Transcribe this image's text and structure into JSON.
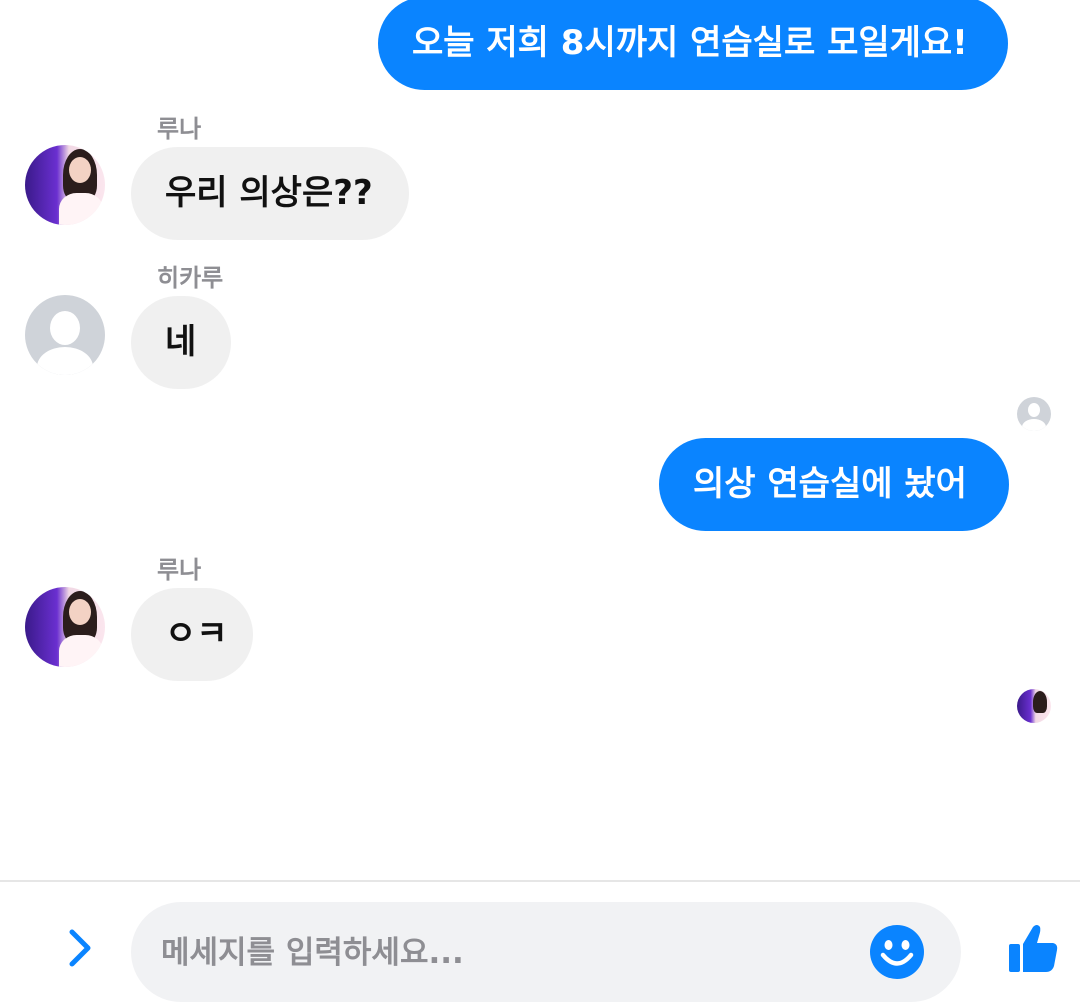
{
  "messages": [
    {
      "direction": "out",
      "text": "오늘 저희 8시까지 연습실로 모일게요!"
    },
    {
      "direction": "in",
      "sender": "루나",
      "text": "우리 의상은??"
    },
    {
      "direction": "in",
      "sender": "히카루",
      "text": "네"
    },
    {
      "direction": "out",
      "text": "의상 연습실에 놨어"
    },
    {
      "direction": "in",
      "sender": "루나",
      "text": "ㅇㅋ"
    }
  ],
  "composer": {
    "placeholder": "메세지를 입력하세요..."
  },
  "icons": {
    "expand": "chevron-right-icon",
    "emoji": "smiley-icon",
    "like": "thumbs-up-icon"
  },
  "colors": {
    "accent": "#0a84ff",
    "incoming_bubble": "#f0f0f0",
    "sender_label": "#8e8e93"
  }
}
